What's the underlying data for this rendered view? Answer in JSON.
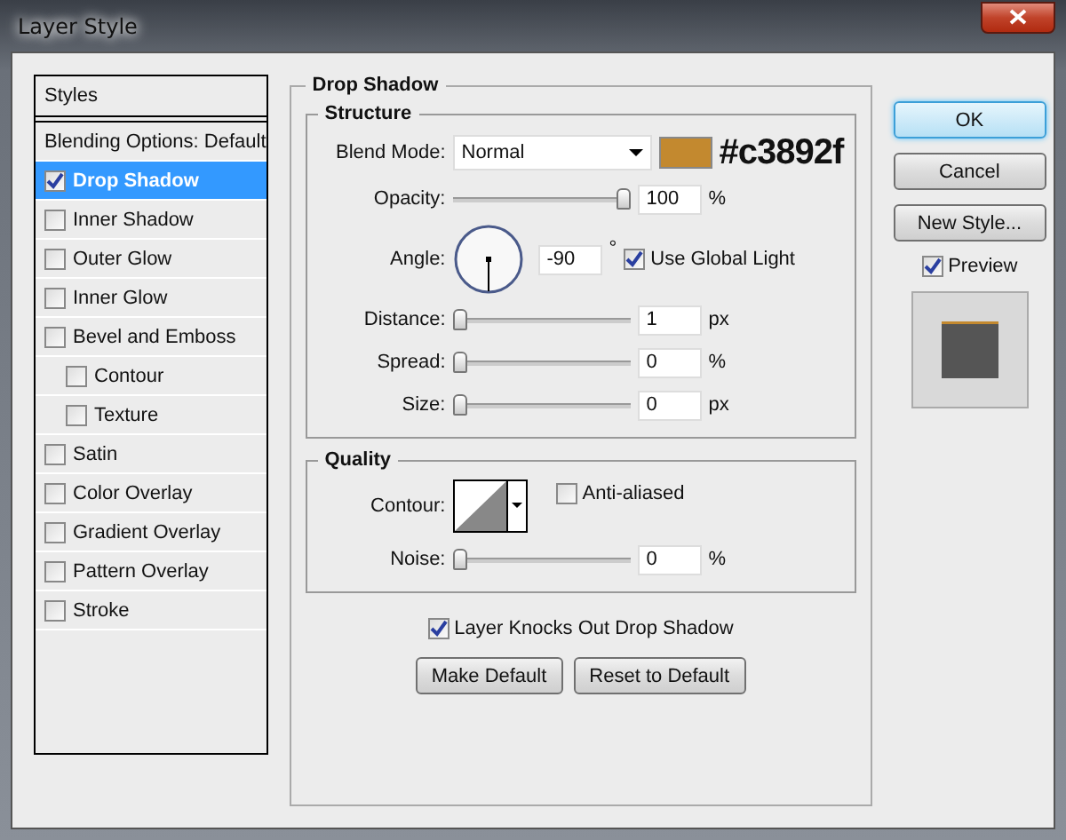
{
  "window": {
    "title": "Layer Style"
  },
  "styles_panel": {
    "header": "Styles",
    "items": [
      {
        "kind": "plain",
        "label": "Blending Options: Default",
        "selected": false
      },
      {
        "kind": "checkbox",
        "label": "Drop Shadow",
        "checked": true,
        "selected": true
      },
      {
        "kind": "checkbox",
        "label": "Inner Shadow",
        "checked": false,
        "selected": false
      },
      {
        "kind": "checkbox",
        "label": "Outer Glow",
        "checked": false,
        "selected": false
      },
      {
        "kind": "checkbox",
        "label": "Inner Glow",
        "checked": false,
        "selected": false
      },
      {
        "kind": "checkbox",
        "label": "Bevel and Emboss",
        "checked": false,
        "selected": false,
        "children": [
          {
            "kind": "checkbox",
            "label": "Contour",
            "checked": false,
            "selected": false
          },
          {
            "kind": "checkbox",
            "label": "Texture",
            "checked": false,
            "selected": false
          }
        ]
      },
      {
        "kind": "checkbox",
        "label": "Satin",
        "checked": false,
        "selected": false
      },
      {
        "kind": "checkbox",
        "label": "Color Overlay",
        "checked": false,
        "selected": false
      },
      {
        "kind": "checkbox",
        "label": "Gradient Overlay",
        "checked": false,
        "selected": false
      },
      {
        "kind": "checkbox",
        "label": "Pattern Overlay",
        "checked": false,
        "selected": false
      },
      {
        "kind": "checkbox",
        "label": "Stroke",
        "checked": false,
        "selected": false
      }
    ]
  },
  "drop_shadow": {
    "title": "Drop Shadow",
    "structure": {
      "title": "Structure",
      "blend_mode": {
        "label": "Blend Mode:",
        "value": "Normal",
        "color": "#c3892f",
        "color_note": "#c3892f"
      },
      "opacity": {
        "label": "Opacity:",
        "level": 1,
        "value": "100",
        "unit": "%"
      },
      "angle": {
        "label": "Angle:",
        "value": "-90",
        "unit": "°",
        "global_light": {
          "label": "Use Global Light",
          "checked": true
        }
      },
      "sliders": [
        {
          "label": "Distance:",
          "level": 0,
          "value": "1",
          "unit": "px"
        },
        {
          "label": "Spread:",
          "level": 0,
          "value": "0",
          "unit": "%"
        },
        {
          "label": "Size:",
          "level": 0,
          "value": "0",
          "unit": "px"
        }
      ]
    },
    "quality": {
      "title": "Quality",
      "contour_label": "Contour:",
      "anti_aliased": {
        "label": "Anti-aliased",
        "checked": false
      },
      "noise": {
        "label": "Noise:",
        "level": 0,
        "value": "0",
        "unit": "%"
      }
    },
    "knockout": {
      "label": "Layer Knocks Out Drop Shadow",
      "checked": true
    },
    "buttons": [
      "Make Default",
      "Reset to Default"
    ]
  },
  "side_buttons": [
    {
      "label": "OK",
      "default": true
    },
    {
      "label": "Cancel",
      "default": false
    },
    {
      "label": "New Style...",
      "default": false
    }
  ],
  "preview": {
    "label": "Preview",
    "checked": true
  }
}
